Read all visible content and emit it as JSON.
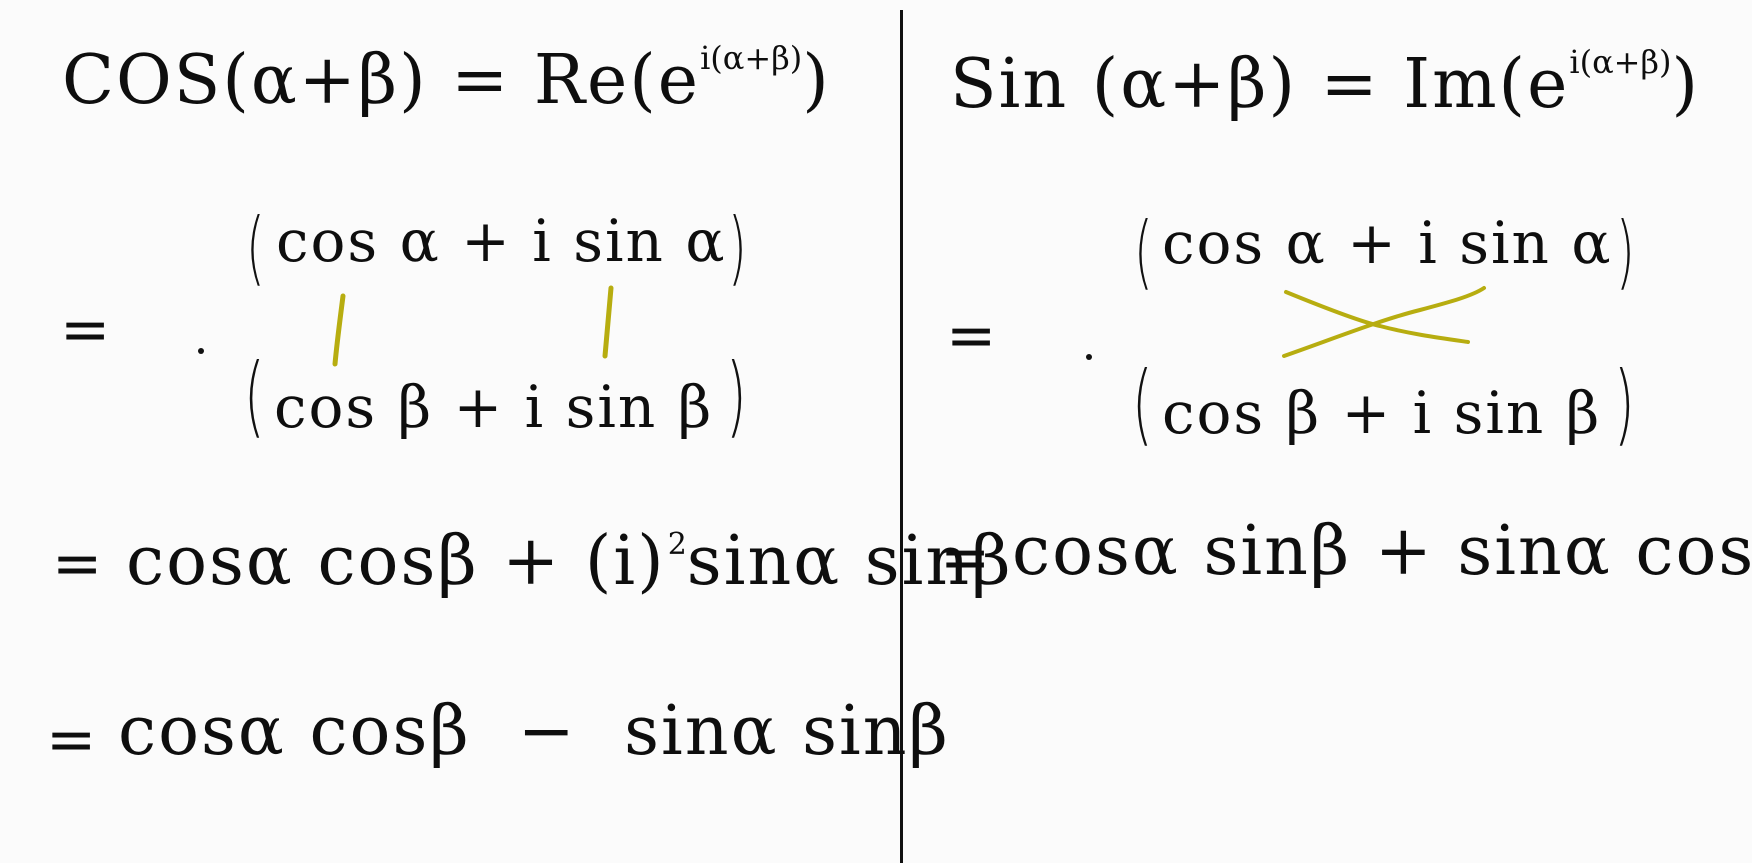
{
  "left": {
    "heading": {
      "lhs": "COS(α+β) = Re(e",
      "exp": "i(α+β)",
      "close": ")"
    },
    "step1": {
      "eq": "=",
      "top": "cos α + i sin α",
      "bottom": "cos β + i sin β"
    },
    "step2": {
      "eq": "=",
      "pre": "cosα cosβ + (i)",
      "sup": "2",
      "post": "sinα sinβ"
    },
    "step3": {
      "eq": "=",
      "text": "cosα cosβ  −  sinα sinβ"
    }
  },
  "right": {
    "heading": {
      "lhs": "Sin (α+β) = Im(e",
      "exp": "i(α+β)",
      "close": ")"
    },
    "step1": {
      "eq": "=",
      "top": "cos α + i sin α",
      "bottom": "cos β + i sin β"
    },
    "step2": {
      "eq": "=",
      "text": "cosα sinβ + sinα cosβ"
    }
  },
  "colors": {
    "ink": "#0e0e0e",
    "highlight": "#b7ad10",
    "background": "#fbfbfb"
  }
}
